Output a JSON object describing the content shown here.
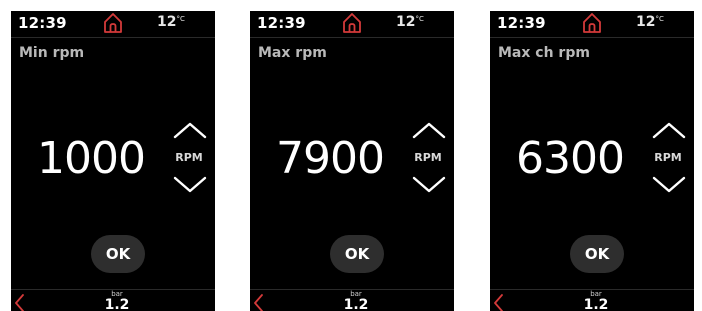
{
  "accent_color": "#d43a3a",
  "screens": [
    {
      "time": "12:39",
      "temperature": "12",
      "temperature_unit": "°C",
      "home_icon": "home-icon",
      "setting_label": "Min rpm",
      "value": "1000",
      "unit": "RPM",
      "ok_label": "OK",
      "back_icon": "chevron-left-icon",
      "pressure_unit": "bar",
      "pressure_value": "1.2"
    },
    {
      "time": "12:39",
      "temperature": "12",
      "temperature_unit": "°C",
      "home_icon": "home-icon",
      "setting_label": "Max rpm",
      "value": "7900",
      "unit": "RPM",
      "ok_label": "OK",
      "back_icon": "chevron-left-icon",
      "pressure_unit": "bar",
      "pressure_value": "1.2"
    },
    {
      "time": "12:39",
      "temperature": "12",
      "temperature_unit": "°C",
      "home_icon": "home-icon",
      "setting_label": "Max ch rpm",
      "value": "6300",
      "unit": "RPM",
      "ok_label": "OK",
      "back_icon": "chevron-left-icon",
      "pressure_unit": "bar",
      "pressure_value": "1.2"
    }
  ]
}
